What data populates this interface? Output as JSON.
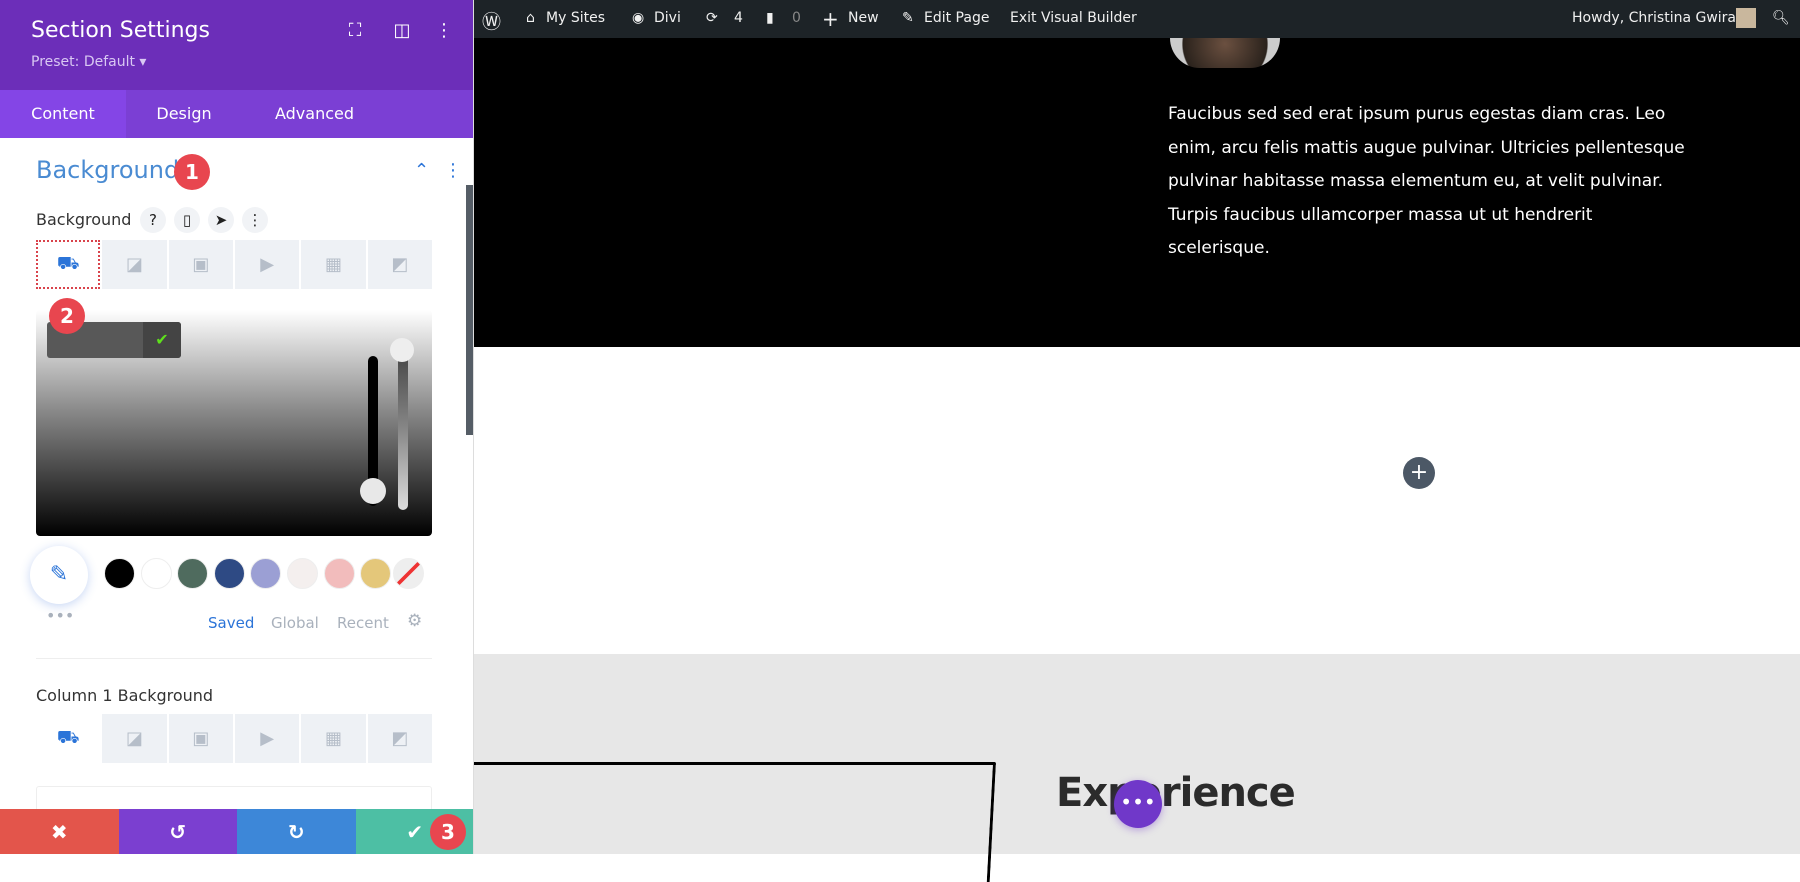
{
  "panel": {
    "title": "Section Settings",
    "preset": "Preset: Default ▾",
    "tabs": [
      "Content",
      "Design",
      "Advanced"
    ],
    "section_title": "Background",
    "badges": [
      "1",
      "2",
      "3"
    ],
    "bg_label": "Background",
    "bg_icons": {
      "help": "?",
      "phone": "▯",
      "cursor": "➤",
      "more": "⋮"
    },
    "palette_links": [
      "Saved",
      "Global",
      "Recent"
    ],
    "swatches": [
      "#000000",
      "#ffffff",
      "#4f6b5e",
      "#2e4a84",
      "#9b9fd4",
      "#f4efee",
      "#f2bcbc",
      "#e4c77a"
    ],
    "column_label": "Column 1 Background",
    "accent": "#4a8bd2",
    "header_color": "#6c2eb9"
  },
  "adminbar": {
    "items": [
      "My Sites",
      "Divi",
      "4",
      "0",
      "New",
      "Edit Page",
      "Exit Visual Builder"
    ],
    "greeting": "Howdy, Christina Gwira"
  },
  "content": {
    "paragraph": "Faucibus sed sed erat ipsum purus egestas diam cras. Leo enim, arcu felis mattis augue pulvinar. Ultricies pellentesque pulvinar habitasse massa elementum eu, at velit pulvinar. Turpis faucibus ullamcorper massa ut ut hendrerit scelerisque.",
    "heading": "Experience"
  }
}
